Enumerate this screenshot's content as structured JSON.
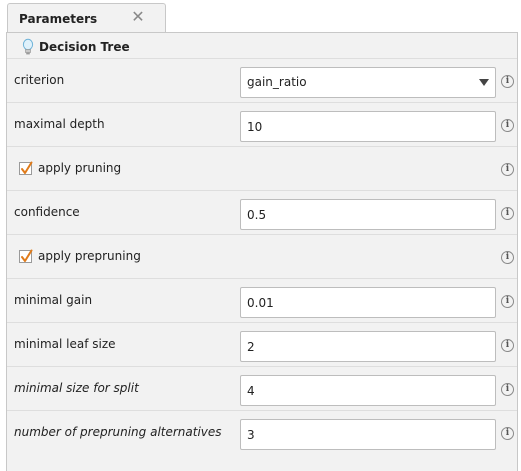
{
  "tab": {
    "title": "Parameters",
    "close_glyph": "✕"
  },
  "operator": {
    "title": "Decision Tree",
    "icon": "lightbulb-icon"
  },
  "colors": {
    "checkmark": "#e07b1a",
    "panel_bg": "#f2f2f2"
  },
  "params": {
    "criterion": {
      "label": "criterion",
      "value": "gain_ratio"
    },
    "maximal_depth": {
      "label": "maximal depth",
      "value": "10"
    },
    "apply_pruning": {
      "label": "apply pruning",
      "checked": true
    },
    "confidence": {
      "label": "confidence",
      "value": "0.5"
    },
    "apply_prepruning": {
      "label": "apply prepruning",
      "checked": true
    },
    "minimal_gain": {
      "label": "minimal gain",
      "value": "0.01"
    },
    "minimal_leaf_size": {
      "label": "minimal leaf size",
      "value": "2"
    },
    "minimal_size_for_split": {
      "label": "minimal size for split",
      "value": "4"
    },
    "number_of_prepruning_alternatives": {
      "label": "number of prepruning alternatives",
      "value": "3"
    }
  },
  "info_glyph": "i"
}
